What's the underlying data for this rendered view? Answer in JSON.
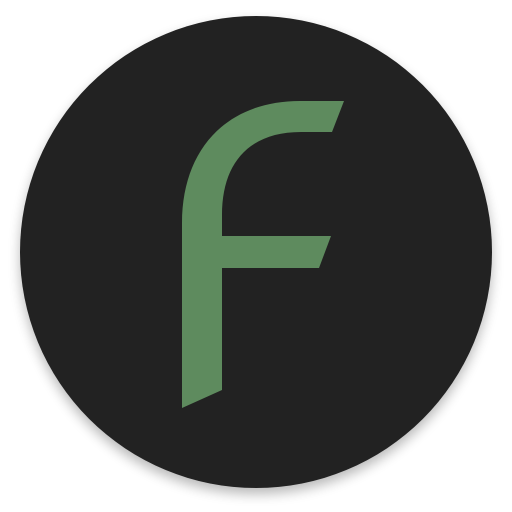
{
  "icon": {
    "name": "F app icon",
    "shape": "circle",
    "glyph": "stylized-f-logo",
    "colors": {
      "badge_background": "#232323",
      "glyph": "#5e8b5e",
      "shadow": "#000000"
    }
  }
}
